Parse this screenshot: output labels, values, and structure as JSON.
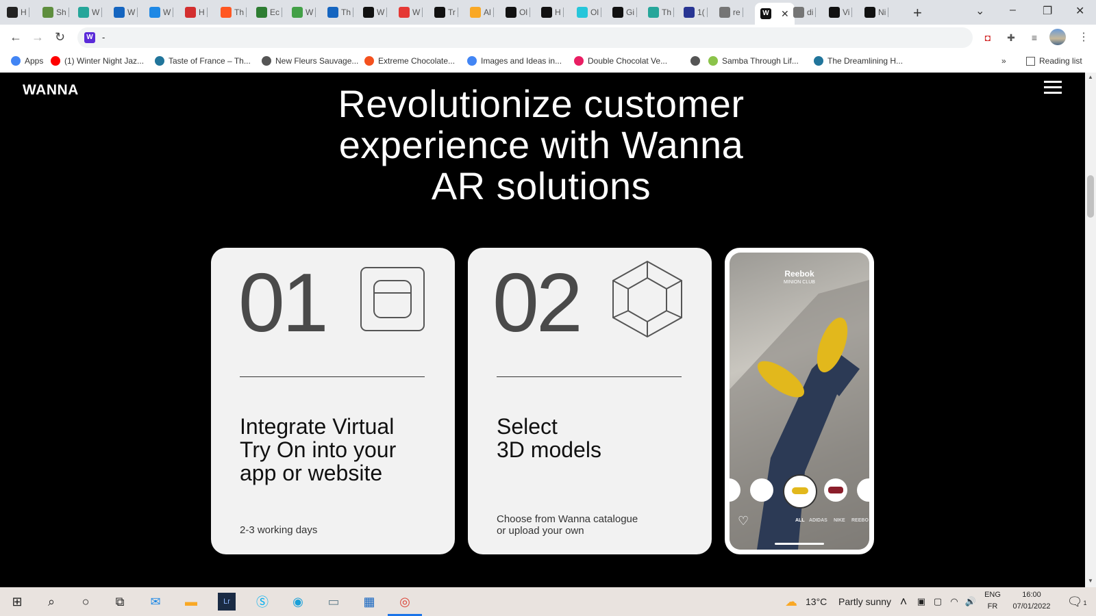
{
  "browser": {
    "tabs": [
      {
        "label": "H",
        "color": "#222222"
      },
      {
        "label": "Sh",
        "color": "#5e8e3e"
      },
      {
        "label": "W",
        "color": "#26a69a"
      },
      {
        "label": "W",
        "color": "#1565c0"
      },
      {
        "label": "W",
        "color": "#1e88e5"
      },
      {
        "label": "H",
        "color": "#d32f2f"
      },
      {
        "label": "Th",
        "color": "#ff5722"
      },
      {
        "label": "Ec",
        "color": "#2e7d32"
      },
      {
        "label": "W",
        "color": "#43a047"
      },
      {
        "label": "Th",
        "color": "#1565c0"
      },
      {
        "label": "W",
        "color": "#111111"
      },
      {
        "label": "W",
        "color": "#e53935"
      },
      {
        "label": "Tr",
        "color": "#111111"
      },
      {
        "label": "Al",
        "color": "#f9a825"
      },
      {
        "label": "Ol",
        "color": "#111111"
      },
      {
        "label": "H",
        "color": "#111111"
      },
      {
        "label": "Ol",
        "color": "#26c6da"
      },
      {
        "label": "Gi",
        "color": "#111111"
      },
      {
        "label": "Th",
        "color": "#26a69a"
      },
      {
        "label": "1(",
        "color": "#283593"
      },
      {
        "label": "re",
        "color": "#757575"
      }
    ],
    "active_tab": {
      "label": "",
      "favicon": "W"
    },
    "after_tabs": [
      {
        "label": "di",
        "color": "#757575"
      },
      {
        "label": "Vi",
        "color": "#111111"
      },
      {
        "label": "Ni",
        "color": "#111111"
      }
    ],
    "new_tab_icon": "+",
    "window_controls": [
      "⌄",
      "–",
      "❐",
      "✕"
    ],
    "address_text": "-",
    "omnibox_favicon": "W",
    "bookmarks": [
      {
        "label": "Apps",
        "color": "#4285f4"
      },
      {
        "label": "(1) Winter Night Jaz...",
        "color": "#ff0000"
      },
      {
        "label": "Taste of France – Th...",
        "color": "#21759b"
      },
      {
        "label": "New Fleurs Sauvage...",
        "color": "#555555"
      },
      {
        "label": "Extreme Chocolate...",
        "color": "#f4511e"
      },
      {
        "label": "Images and Ideas in...",
        "color": "#4285f4"
      },
      {
        "label": "Double Chocolat Ve...",
        "color": "#e91e63"
      },
      {
        "label": "",
        "color": "#555555"
      },
      {
        "label": "Samba Through Lif...",
        "color": "#8bc34a"
      },
      {
        "label": "The Dreamlining H...",
        "color": "#21759b"
      }
    ],
    "bookmarks_overflow": "»",
    "reading_list": "Reading list"
  },
  "site": {
    "logo": "WANNA",
    "headline": [
      "Revolutionize customer",
      "experience with Wanna",
      "AR solutions"
    ],
    "cards": [
      {
        "number": "01",
        "title": [
          "Integrate Virtual",
          "Try On into your",
          "app or website"
        ],
        "subtitle": [
          "2-3 working days"
        ],
        "icon": "box-outline-icon"
      },
      {
        "number": "02",
        "title": [
          "Select",
          "3D models"
        ],
        "subtitle": [
          "Choose from Wanna catalogue",
          "or upload your own"
        ],
        "icon": "cube-wireframe-icon"
      }
    ],
    "phone": {
      "brand": "Reebok",
      "brand_sub": "MINION CLUB",
      "categories": [
        "ALL",
        "ADIDAS",
        "NIKE",
        "REEBO"
      ]
    }
  },
  "taskbar": {
    "weather_temp": "13°C",
    "weather_text": "Partly sunny",
    "lang_top": "ENG",
    "lang_bottom": "FR",
    "time": "16:00",
    "date": "07/01/2022",
    "notification_count": "1"
  }
}
